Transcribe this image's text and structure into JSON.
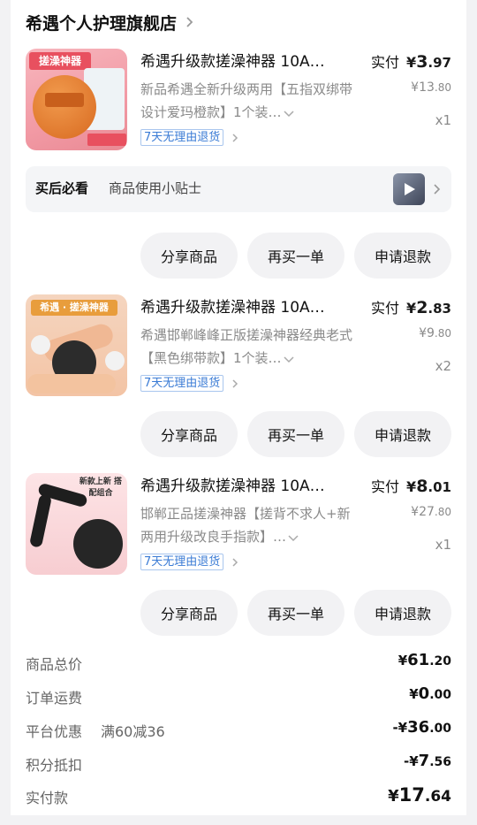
{
  "shop": {
    "name": "希遇个人护理旗舰店"
  },
  "items": [
    {
      "title": "希遇升级款搓澡神器 10A…",
      "desc": "新品希遇全新升级两用【五指双绑带设计爱玛橙款】1个装…",
      "tag": "7天无理由退货",
      "paid_label": "实付",
      "paid_currency": "¥",
      "paid_int": "3",
      "paid_dec": ".97",
      "orig_int": "¥13",
      "orig_dec": ".80",
      "qty": "x1",
      "thumb_text": "搓澡神器"
    },
    {
      "title": "希遇升级款搓澡神器 10A…",
      "desc": "希遇邯郸峰峰正版搓澡神器经典老式【黑色绑带款】1个装…",
      "tag": "7天无理由退货",
      "paid_label": "实付",
      "paid_currency": "¥",
      "paid_int": "2",
      "paid_dec": ".83",
      "orig_int": "¥9",
      "orig_dec": ".80",
      "qty": "x2",
      "thumb_text": "希遇 · 搓澡神器"
    },
    {
      "title": "希遇升级款搓澡神器 10A…",
      "desc": "邯郸正品搓澡神器【搓背不求人+新两用升级改良手指款】…",
      "tag": "7天无理由退货",
      "paid_label": "实付",
      "paid_currency": "¥",
      "paid_int": "8",
      "paid_dec": ".01",
      "orig_int": "¥27",
      "orig_dec": ".80",
      "qty": "x1",
      "thumb_text": "新款上新 搭配组合"
    }
  ],
  "tips": {
    "label": "买后必看",
    "text": "商品使用小贴士"
  },
  "buttons": {
    "share": "分享商品",
    "rebuy": "再买一单",
    "refund": "申请退款"
  },
  "summary": {
    "goods_total": {
      "label": "商品总价",
      "cur": "¥",
      "int": "61",
      "dec": ".20"
    },
    "shipping": {
      "label": "订单运费",
      "cur": "¥",
      "int": "0",
      "dec": ".00"
    },
    "platform_discount": {
      "label": "平台优惠",
      "note": "满60减36",
      "cur": "-¥",
      "int": "36",
      "dec": ".00"
    },
    "points": {
      "label": "积分抵扣",
      "cur": "-¥",
      "int": "7",
      "dec": ".56"
    },
    "paid": {
      "label": "实付款",
      "cur": "¥",
      "int": "17",
      "dec": ".64"
    }
  }
}
